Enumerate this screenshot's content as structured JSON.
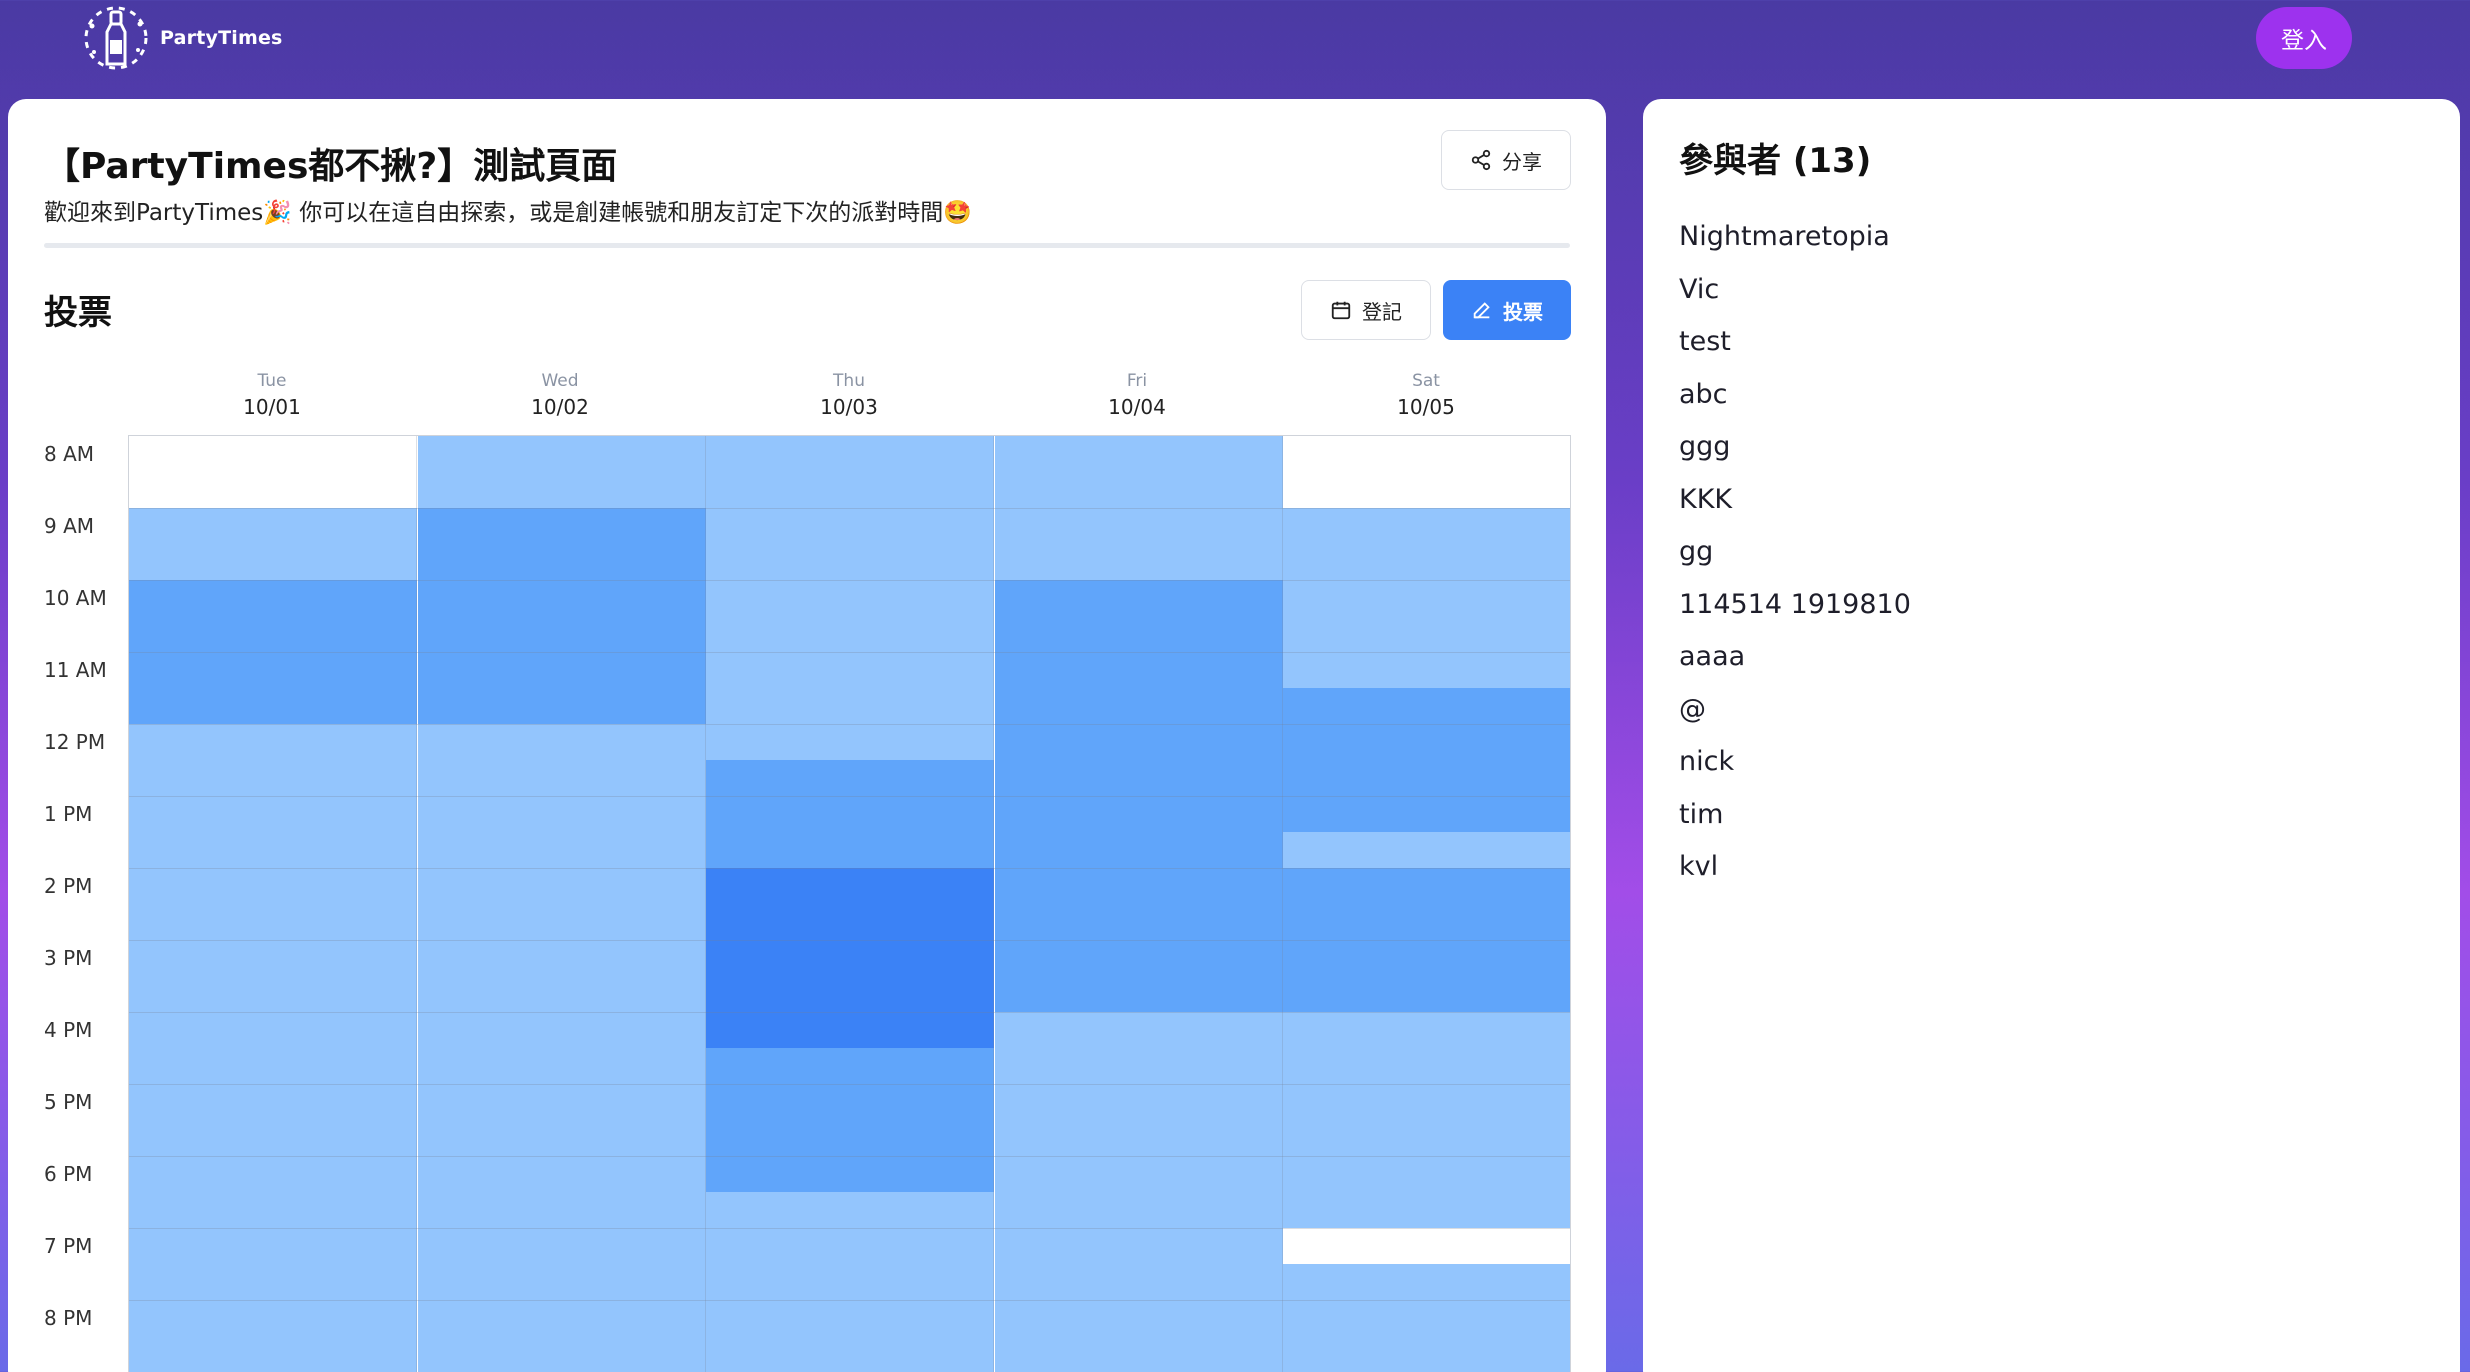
{
  "header": {
    "logo_text": "PartyTimes",
    "login_label": "登入"
  },
  "event": {
    "title": "【PartyTimes都不揪?】測試頁面",
    "description": "歡迎來到PartyTimes🎉 你可以在這自由探索，或是創建帳號和朋友訂定下次的派對時間🤩",
    "share_label": "分享"
  },
  "vote": {
    "title": "投票",
    "register_label": "登記",
    "vote_label": "投票"
  },
  "days": [
    {
      "dow": "Tue",
      "date": "10/01"
    },
    {
      "dow": "Wed",
      "date": "10/02"
    },
    {
      "dow": "Thu",
      "date": "10/03"
    },
    {
      "dow": "Fri",
      "date": "10/04"
    },
    {
      "dow": "Sat",
      "date": "10/05"
    }
  ],
  "times": [
    "8 AM",
    "9 AM",
    "10 AM",
    "11 AM",
    "12 PM",
    "1 PM",
    "2 PM",
    "3 PM",
    "4 PM",
    "5 PM",
    "6 PM",
    "7 PM",
    "8 PM"
  ],
  "availability_levels": {
    "note": "per-day list of [start_hour, end_hour, level]; level 0=none,1=light,2=medium,3=dark",
    "colors": [
      "#ffffff",
      "#93c5fd",
      "#60a5fa",
      "#3b82f6"
    ],
    "days": [
      [
        [
          8,
          9,
          0
        ],
        [
          9,
          10,
          1
        ],
        [
          10,
          12,
          2
        ],
        [
          12,
          21,
          1
        ]
      ],
      [
        [
          8,
          9,
          1
        ],
        [
          9,
          12,
          2
        ],
        [
          12,
          21,
          1
        ]
      ],
      [
        [
          8,
          12.5,
          1
        ],
        [
          12.5,
          14,
          2
        ],
        [
          14,
          16.5,
          3
        ],
        [
          16.5,
          18.5,
          2
        ],
        [
          18.5,
          21,
          1
        ]
      ],
      [
        [
          8,
          10,
          1
        ],
        [
          10,
          16,
          2
        ],
        [
          16,
          21,
          1
        ]
      ],
      [
        [
          8,
          9,
          0
        ],
        [
          9,
          11.5,
          1
        ],
        [
          11.5,
          13.5,
          2
        ],
        [
          13.5,
          14,
          1
        ],
        [
          14,
          16,
          2
        ],
        [
          16,
          19,
          1
        ],
        [
          19,
          19.5,
          0
        ],
        [
          19.5,
          21,
          1
        ]
      ]
    ]
  },
  "participants": {
    "title": "參與者 (13)",
    "names": [
      "Nightmaretopia",
      "Vic",
      "test",
      "abc",
      "ggg",
      "KKK",
      "gg",
      "114514 1919810",
      "aaaa",
      "@",
      "nick",
      "tim",
      "kvl"
    ]
  }
}
